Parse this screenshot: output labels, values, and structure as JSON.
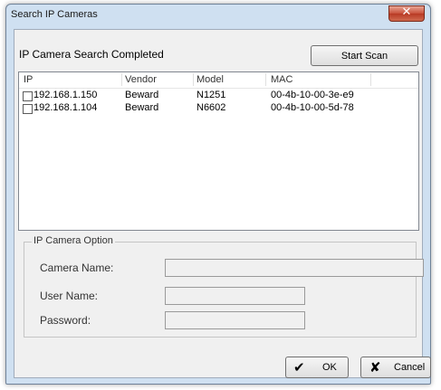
{
  "window": {
    "title": "Search IP Cameras"
  },
  "status": "IP Camera Search Completed",
  "buttons": {
    "start_scan": "Start Scan",
    "ok": "OK",
    "cancel": "Cancel"
  },
  "table": {
    "columns": [
      "IP",
      "Vendor",
      "Model",
      "MAC"
    ],
    "rows": [
      {
        "ip": "192.168.1.150",
        "vendor": "Beward",
        "model": "N1251",
        "mac": "00-4b-10-00-3e-e9",
        "checked": false
      },
      {
        "ip": "192.168.1.104",
        "vendor": "Beward",
        "model": "N6602",
        "mac": "00-4b-10-00-5d-78",
        "checked": false
      }
    ]
  },
  "option_group": {
    "legend": "IP Camera Option",
    "camera_name_label": "Camera Name:",
    "user_name_label": "User Name:",
    "password_label": "Password:",
    "camera_name_value": "",
    "user_name_value": "",
    "password_value": ""
  },
  "icons": {
    "close": "close-icon",
    "ok": "checkmark-icon",
    "cancel": "x-mark-icon"
  }
}
